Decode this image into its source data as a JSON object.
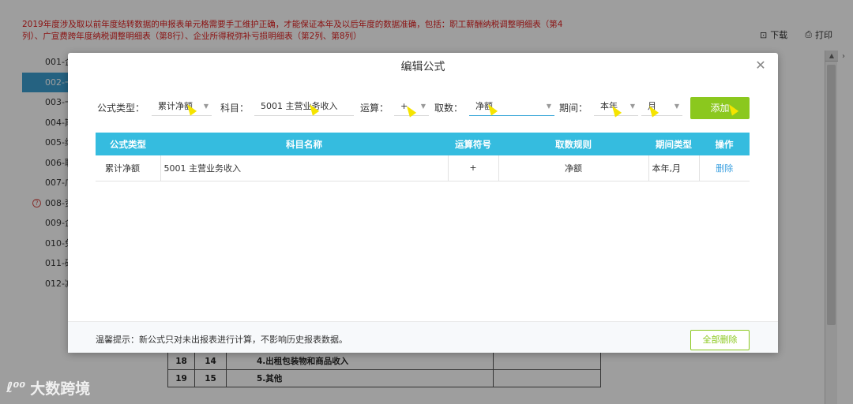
{
  "background": {
    "notice": "2019年度涉及取以前年度结转数据的申报表单元格需要手工维护正确，才能保证本年及以后年度的数据准确，包括：职工薪酬纳税调整明细表（第4列）、广宣费跨年度纳税调整明细表（第8行）、企业所得税弥补亏损明细表（第2列、第8列）",
    "download": "下载",
    "print": "打印",
    "sidebar": [
      "001-企",
      "002-一",
      "003-一",
      "004-期",
      "005-纳",
      "006-职",
      "007-广",
      "",
      "008-资",
      "009-企",
      "010-免",
      "011-研",
      "012-减"
    ],
    "table_rows": [
      {
        "no": "18",
        "seq": "14",
        "item": "4.出租包装物和商品收入"
      },
      {
        "no": "19",
        "seq": "15",
        "item": "5.其他"
      }
    ]
  },
  "watermark": "大数跨境",
  "modal": {
    "title": "编辑公式",
    "form": {
      "type_label": "公式类型：",
      "type_value": "累计净额",
      "subject_label": "科目：",
      "subject_value": "5001 主营业务收入",
      "op_label": "运算：",
      "op_value": "+",
      "fetch_label": "取数：",
      "fetch_value": "净额",
      "period_label": "期间：",
      "period_year": "本年",
      "period_month": "月",
      "add_label": "添加"
    },
    "table": {
      "headers": [
        "公式类型",
        "科目名称",
        "运算符号",
        "取数规则",
        "期间类型",
        "操作"
      ],
      "rows": [
        {
          "type": "累计净额",
          "subject": "5001 主营业务收入",
          "op": "+",
          "rule": "净额",
          "period": "本年,月",
          "action": "删除"
        }
      ]
    },
    "footer": {
      "tip": "温馨提示：新公式只对未出报表进行计算，不影响历史报表数据。",
      "delete_all_label": "全部删除"
    }
  }
}
